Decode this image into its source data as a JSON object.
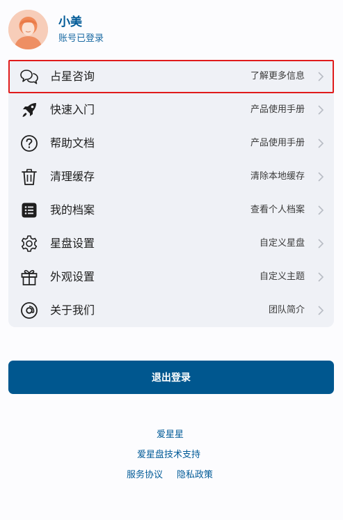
{
  "profile": {
    "name": "小美",
    "status": "账号已登录"
  },
  "menu": [
    {
      "label": "占星咨询",
      "hint": "了解更多信息",
      "icon": "chat-bubbles-icon",
      "highlighted": true
    },
    {
      "label": "快速入门",
      "hint": "产品使用手册",
      "icon": "rocket-icon"
    },
    {
      "label": "帮助文档",
      "hint": "产品使用手册",
      "icon": "question-circle-icon"
    },
    {
      "label": "清理缓存",
      "hint": "清除本地缓存",
      "icon": "trash-icon"
    },
    {
      "label": "我的档案",
      "hint": "查看个人档案",
      "icon": "list-icon"
    },
    {
      "label": "星盘设置",
      "hint": "自定义星盘",
      "icon": "gear-icon"
    },
    {
      "label": "外观设置",
      "hint": "自定义主题",
      "icon": "gift-icon"
    },
    {
      "label": "关于我们",
      "hint": "团队简介",
      "icon": "at-sign-icon"
    }
  ],
  "logout_label": "退出登录",
  "footer": {
    "brand": "爱星星",
    "support": "爱星盘技术支持",
    "terms": "服务协议",
    "privacy": "隐私政策"
  },
  "colors": {
    "accent": "#00578f",
    "card_background": "#eff1f6",
    "highlight_border": "#e01b1b"
  }
}
